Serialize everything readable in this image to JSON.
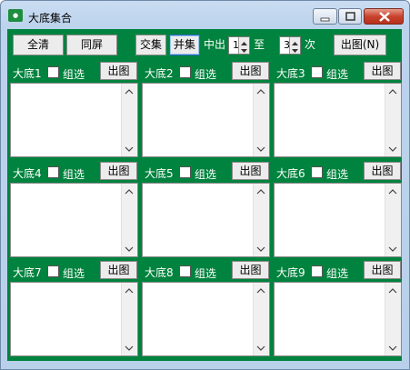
{
  "window": {
    "title": "大底集合",
    "icon": "app-icon"
  },
  "toolbar": {
    "all_clear": "全清",
    "same_screen": "同屏",
    "intersect": "交集",
    "union": "并集",
    "hit_label": "中出",
    "from_value": "1",
    "to_label": "至",
    "to_value": "3",
    "times_label": "次",
    "output_all": "出图(N)"
  },
  "panels": [
    {
      "name": "大底1",
      "group_label": "组选",
      "output_label": "出图"
    },
    {
      "name": "大底2",
      "group_label": "组选",
      "output_label": "出图"
    },
    {
      "name": "大底3",
      "group_label": "组选",
      "output_label": "出图"
    },
    {
      "name": "大底4",
      "group_label": "组选",
      "output_label": "出图"
    },
    {
      "name": "大底5",
      "group_label": "组选",
      "output_label": "出图"
    },
    {
      "name": "大底6",
      "group_label": "组选",
      "output_label": "出图"
    },
    {
      "name": "大底7",
      "group_label": "组选",
      "output_label": "出图"
    },
    {
      "name": "大底8",
      "group_label": "组选",
      "output_label": "出图"
    },
    {
      "name": "大底9",
      "group_label": "组选",
      "output_label": "出图"
    }
  ],
  "colors": {
    "background": "#00833e",
    "close": "#c8432e"
  }
}
